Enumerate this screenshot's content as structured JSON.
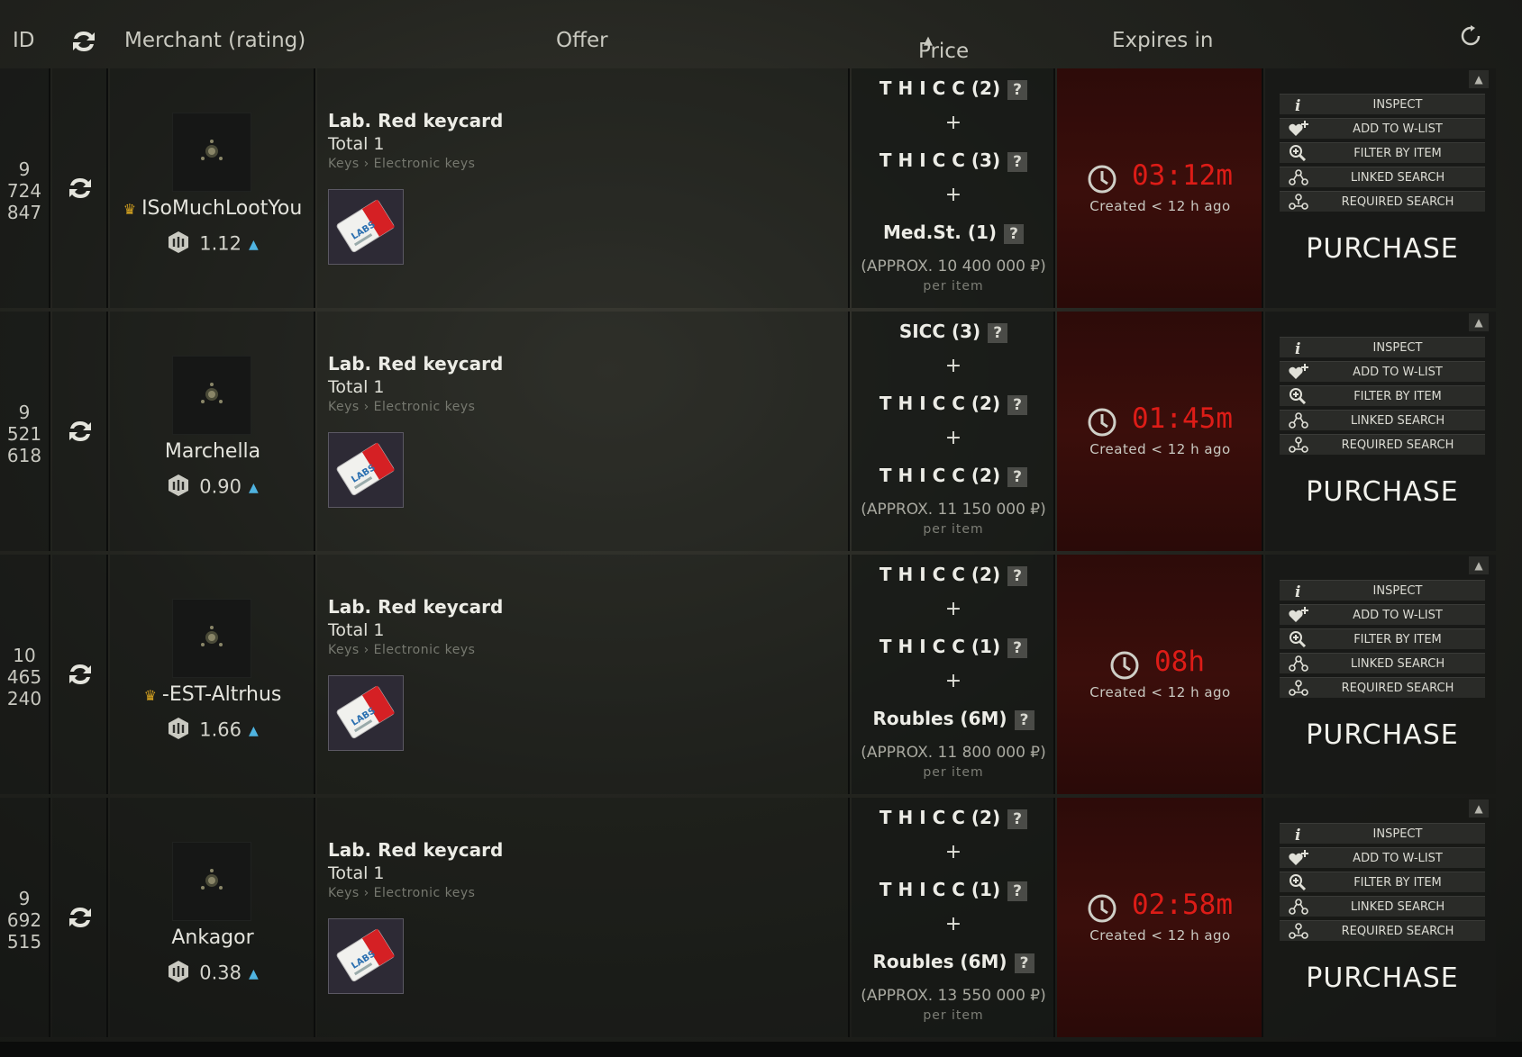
{
  "header": {
    "id": "ID",
    "merchant": "Merchant (rating)",
    "offer": "Offer",
    "price": "Price",
    "expires": "Expires in"
  },
  "actions": [
    "INSPECT",
    "ADD TO W-LIST",
    "FILTER BY ITEM",
    "LINKED SEARCH",
    "REQUIRED SEARCH"
  ],
  "purchase_label": "PURCHASE",
  "plus": "+",
  "per_item": "per item",
  "offers": [
    {
      "id": [
        "9",
        "724",
        "847"
      ],
      "merchant": "ISoMuchLootYou",
      "crown": true,
      "rating": "1.12",
      "item": "Lab. Red keycard",
      "total": "Total 1",
      "category": "Keys › Electronic keys",
      "price": [
        "T H I C C (2)",
        "T H I C C (3)",
        "Med.St. (1)"
      ],
      "approx": "(APPROX. 10 400 000 ₽)",
      "time": "03:12m",
      "created": "Created < 12 h ago"
    },
    {
      "id": [
        "9",
        "521",
        "618"
      ],
      "merchant": "Marchella",
      "crown": false,
      "rating": "0.90",
      "item": "Lab. Red keycard",
      "total": "Total 1",
      "category": "Keys › Electronic keys",
      "price": [
        "SICC (3)",
        "T H I C C (2)",
        "T H I C C (2)"
      ],
      "approx": "(APPROX. 11 150 000 ₽)",
      "time": "01:45m",
      "created": "Created < 12 h ago"
    },
    {
      "id": [
        "10",
        "465",
        "240"
      ],
      "merchant": "-EST-Altrhus",
      "crown": true,
      "rating": "1.66",
      "item": "Lab. Red keycard",
      "total": "Total 1",
      "category": "Keys › Electronic keys",
      "price": [
        "T H I C C (2)",
        "T H I C C (1)",
        "Roubles (6M)"
      ],
      "approx": "(APPROX. 11 800 000 ₽)",
      "time": "08h",
      "created": "Created < 12 h ago"
    },
    {
      "id": [
        "9",
        "692",
        "515"
      ],
      "merchant": "Ankagor",
      "crown": false,
      "rating": "0.38",
      "item": "Lab. Red keycard",
      "total": "Total 1",
      "category": "Keys › Electronic keys",
      "price": [
        "T H I C C (2)",
        "T H I C C (1)",
        "Roubles (6M)"
      ],
      "approx": "(APPROX. 13 550 000 ₽)",
      "time": "02:58m",
      "created": "Created < 12 h ago"
    }
  ]
}
